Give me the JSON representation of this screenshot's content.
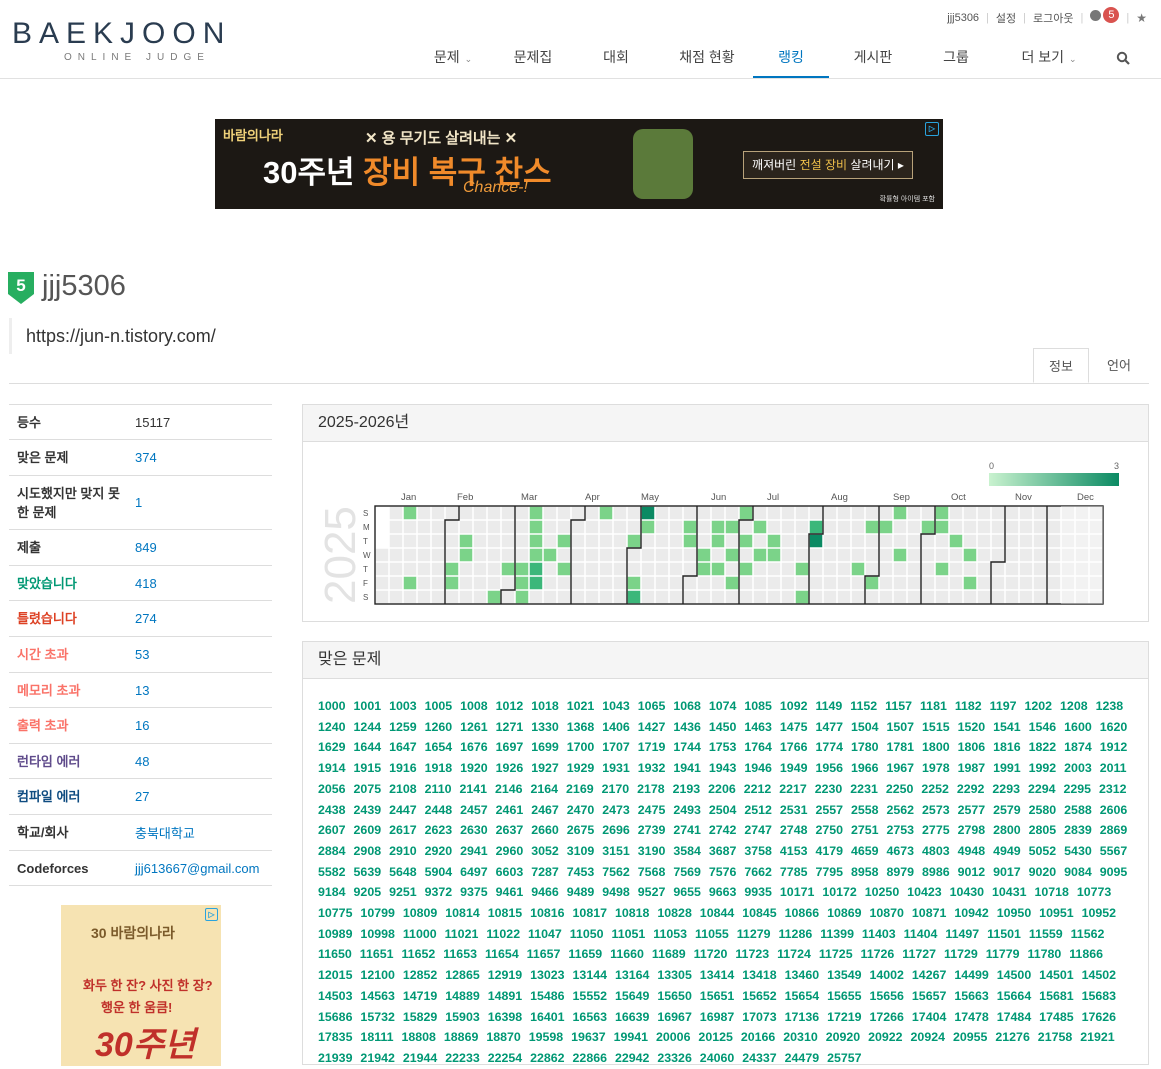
{
  "header": {
    "logo_main": "BAEKJOON",
    "logo_sub": "ONLINE JUDGE",
    "top_links": [
      "jjj5306",
      "설정",
      "로그아웃"
    ],
    "notification_count": "5",
    "nav": [
      "문제",
      "문제집",
      "대회",
      "채점 현황",
      "랭킹",
      "게시판",
      "그룹",
      "더 보기"
    ],
    "active_nav": "랭킹"
  },
  "ad_banner": {
    "logo_text": "바람의나라",
    "sub": "용 무기도 살려내는",
    "big_number": "30",
    "big_prefix": "주년",
    "big_highlight": "장비 복구 찬스",
    "chance": "Chance-!",
    "button_prefix": "깨져버린",
    "button_highlight": "전설 장비",
    "button_suffix": "살려내기 ▸",
    "note": "확률형 아이템 포함"
  },
  "profile": {
    "tier": "5",
    "username": "jjj5306",
    "bio": "https://jun-n.tistory.com/",
    "tabs": [
      "정보",
      "언어"
    ],
    "active_tab": "정보"
  },
  "stats": [
    {
      "label": "등수",
      "value": "15117",
      "label_color": "#333333",
      "link": false
    },
    {
      "label": "맞은 문제",
      "value": "374",
      "label_color": "#333333",
      "link": true
    },
    {
      "label": "시도했지만 맞지 못한 문제",
      "value": "1",
      "label_color": "#333333",
      "link": true
    },
    {
      "label": "제출",
      "value": "849",
      "label_color": "#333333",
      "link": true
    },
    {
      "label": "맞았습니다",
      "value": "418",
      "label_color": "#009874",
      "link": true
    },
    {
      "label": "틀렸습니다",
      "value": "274",
      "label_color": "#dd4124",
      "link": true
    },
    {
      "label": "시간 초과",
      "value": "53",
      "label_color": "#fa7268",
      "link": true
    },
    {
      "label": "메모리 초과",
      "value": "13",
      "label_color": "#fa7268",
      "link": true
    },
    {
      "label": "출력 초과",
      "value": "16",
      "label_color": "#fa7268",
      "link": true
    },
    {
      "label": "런타임 에러",
      "value": "48",
      "label_color": "#5f4b8b",
      "link": true
    },
    {
      "label": "컴파일 에러",
      "value": "27",
      "label_color": "#0f4c81",
      "link": true
    },
    {
      "label": "학교/회사",
      "value": "충북대학교",
      "label_color": "#333333",
      "link": true
    },
    {
      "label": "Codeforces",
      "value": "jjj613667@gmail.com",
      "label_color": "#333333",
      "link": true
    }
  ],
  "side_ad": {
    "logo_text": "30 바람의나라",
    "line1": "화두 한 잔? 사진 한 장?",
    "line2": "행운 한 움큼!",
    "big": "30주년"
  },
  "heatmap": {
    "title": "2025-2026년",
    "year_label": "2025",
    "legend_min": "0",
    "legend_max": "3",
    "months": [
      "Jan",
      "Feb",
      "Mar",
      "Apr",
      "May",
      "Jun",
      "Jul",
      "Aug",
      "Sep",
      "Oct",
      "Nov",
      "Dec"
    ],
    "weekdays": [
      "S",
      "M",
      "T",
      "W",
      "T",
      "F",
      "S"
    ],
    "colors": {
      "empty": "#ebebeb",
      "l1": "#7bd389",
      "l2": "#3cb77a",
      "l3": "#0b8a63"
    },
    "cells": [
      [
        2,
        0,
        1
      ],
      [
        2,
        5,
        1
      ],
      [
        5,
        4,
        1
      ],
      [
        5,
        5,
        1
      ],
      [
        6,
        2,
        1
      ],
      [
        6,
        3,
        1
      ],
      [
        8,
        6,
        1
      ],
      [
        9,
        4,
        1
      ],
      [
        10,
        4,
        1
      ],
      [
        10,
        5,
        1
      ],
      [
        10,
        6,
        1
      ],
      [
        11,
        3,
        1
      ],
      [
        11,
        5,
        1
      ],
      [
        11,
        1,
        1
      ],
      [
        11,
        0,
        1
      ],
      [
        11,
        2,
        1
      ],
      [
        11,
        4,
        2
      ],
      [
        11,
        5,
        2
      ],
      [
        12,
        3,
        1
      ],
      [
        13,
        2,
        1
      ],
      [
        13,
        4,
        1
      ],
      [
        16,
        0,
        1
      ],
      [
        18,
        2,
        1
      ],
      [
        18,
        5,
        1
      ],
      [
        18,
        6,
        2
      ],
      [
        19,
        0,
        3
      ],
      [
        19,
        1,
        1
      ],
      [
        22,
        1,
        1
      ],
      [
        22,
        2,
        1
      ],
      [
        23,
        3,
        1
      ],
      [
        23,
        4,
        1
      ],
      [
        24,
        2,
        1
      ],
      [
        24,
        1,
        1
      ],
      [
        24,
        4,
        1
      ],
      [
        25,
        1,
        1
      ],
      [
        25,
        3,
        1
      ],
      [
        25,
        5,
        1
      ],
      [
        26,
        0,
        1
      ],
      [
        26,
        2,
        1
      ],
      [
        26,
        4,
        1
      ],
      [
        27,
        1,
        1
      ],
      [
        27,
        3,
        1
      ],
      [
        28,
        2,
        1
      ],
      [
        28,
        3,
        1
      ],
      [
        30,
        4,
        1
      ],
      [
        30,
        6,
        1
      ],
      [
        31,
        1,
        2
      ],
      [
        31,
        2,
        3
      ],
      [
        34,
        4,
        1
      ],
      [
        35,
        1,
        1
      ],
      [
        35,
        5,
        1
      ],
      [
        36,
        1,
        1
      ],
      [
        37,
        0,
        1
      ],
      [
        37,
        3,
        1
      ],
      [
        39,
        1,
        1
      ],
      [
        40,
        0,
        1
      ],
      [
        40,
        1,
        1
      ],
      [
        40,
        4,
        1
      ],
      [
        41,
        2,
        1
      ],
      [
        42,
        3,
        1
      ],
      [
        42,
        5,
        1
      ]
    ]
  },
  "solved": {
    "title": "맞은 문제",
    "problems": [
      "1000",
      "1001",
      "1003",
      "1005",
      "1008",
      "1012",
      "1018",
      "1021",
      "1043",
      "1065",
      "1068",
      "1074",
      "1085",
      "1092",
      "1149",
      "1152",
      "1157",
      "1181",
      "1182",
      "1197",
      "1202",
      "1208",
      "1238",
      "1240",
      "1244",
      "1259",
      "1260",
      "1261",
      "1271",
      "1330",
      "1368",
      "1406",
      "1427",
      "1436",
      "1450",
      "1463",
      "1475",
      "1477",
      "1504",
      "1507",
      "1515",
      "1520",
      "1541",
      "1546",
      "1600",
      "1620",
      "1629",
      "1644",
      "1647",
      "1654",
      "1676",
      "1697",
      "1699",
      "1700",
      "1707",
      "1719",
      "1744",
      "1753",
      "1764",
      "1766",
      "1774",
      "1780",
      "1781",
      "1800",
      "1806",
      "1816",
      "1822",
      "1874",
      "1912",
      "1914",
      "1915",
      "1916",
      "1918",
      "1920",
      "1926",
      "1927",
      "1929",
      "1931",
      "1932",
      "1941",
      "1943",
      "1946",
      "1949",
      "1956",
      "1966",
      "1967",
      "1978",
      "1987",
      "1991",
      "1992",
      "2003",
      "2011",
      "2056",
      "2075",
      "2108",
      "2110",
      "2141",
      "2146",
      "2164",
      "2169",
      "2170",
      "2178",
      "2193",
      "2206",
      "2212",
      "2217",
      "2230",
      "2231",
      "2250",
      "2252",
      "2292",
      "2293",
      "2294",
      "2295",
      "2312",
      "2438",
      "2439",
      "2447",
      "2448",
      "2457",
      "2461",
      "2467",
      "2470",
      "2473",
      "2475",
      "2493",
      "2504",
      "2512",
      "2531",
      "2557",
      "2558",
      "2562",
      "2573",
      "2577",
      "2579",
      "2580",
      "2588",
      "2606",
      "2607",
      "2609",
      "2617",
      "2623",
      "2630",
      "2637",
      "2660",
      "2675",
      "2696",
      "2739",
      "2741",
      "2742",
      "2747",
      "2748",
      "2750",
      "2751",
      "2753",
      "2775",
      "2798",
      "2800",
      "2805",
      "2839",
      "2869",
      "2884",
      "2908",
      "2910",
      "2920",
      "2941",
      "2960",
      "3052",
      "3109",
      "3151",
      "3190",
      "3584",
      "3687",
      "3758",
      "4153",
      "4179",
      "4659",
      "4673",
      "4803",
      "4948",
      "4949",
      "5052",
      "5430",
      "5567",
      "5582",
      "5639",
      "5648",
      "5904",
      "6497",
      "6603",
      "7287",
      "7453",
      "7562",
      "7568",
      "7569",
      "7576",
      "7662",
      "7785",
      "7795",
      "8958",
      "8979",
      "8986",
      "9012",
      "9017",
      "9020",
      "9084",
      "9095",
      "9184",
      "9205",
      "9251",
      "9372",
      "9375",
      "9461",
      "9466",
      "9489",
      "9498",
      "9527",
      "9655",
      "9663",
      "9935",
      "10171",
      "10172",
      "10250",
      "10423",
      "10430",
      "10431",
      "10718",
      "10773",
      "10775",
      "10799",
      "10809",
      "10814",
      "10815",
      "10816",
      "10817",
      "10818",
      "10828",
      "10844",
      "10845",
      "10866",
      "10869",
      "10870",
      "10871",
      "10942",
      "10950",
      "10951",
      "10952",
      "10989",
      "10998",
      "11000",
      "11021",
      "11022",
      "11047",
      "11050",
      "11051",
      "11053",
      "11055",
      "11279",
      "11286",
      "11399",
      "11403",
      "11404",
      "11497",
      "11501",
      "11559",
      "11562",
      "11650",
      "11651",
      "11652",
      "11653",
      "11654",
      "11657",
      "11659",
      "11660",
      "11689",
      "11720",
      "11723",
      "11724",
      "11725",
      "11726",
      "11727",
      "11729",
      "11779",
      "11780",
      "11866",
      "12015",
      "12100",
      "12852",
      "12865",
      "12919",
      "13023",
      "13144",
      "13164",
      "13305",
      "13414",
      "13418",
      "13460",
      "13549",
      "14002",
      "14267",
      "14499",
      "14500",
      "14501",
      "14502",
      "14503",
      "14563",
      "14719",
      "14889",
      "14891",
      "15486",
      "15552",
      "15649",
      "15650",
      "15651",
      "15652",
      "15654",
      "15655",
      "15656",
      "15657",
      "15663",
      "15664",
      "15681",
      "15683",
      "15686",
      "15732",
      "15829",
      "15903",
      "16398",
      "16401",
      "16563",
      "16639",
      "16967",
      "16987",
      "17073",
      "17136",
      "17219",
      "17266",
      "17404",
      "17478",
      "17484",
      "17485",
      "17626",
      "17835",
      "18111",
      "18808",
      "18869",
      "18870",
      "19598",
      "19637",
      "19941",
      "20006",
      "20125",
      "20166",
      "20310",
      "20920",
      "20922",
      "20924",
      "20955",
      "21276",
      "21758",
      "21921",
      "21939",
      "21942",
      "21944",
      "22233",
      "22254",
      "22862",
      "22866",
      "22942",
      "23326",
      "24060",
      "24337",
      "24479",
      "25757"
    ]
  }
}
